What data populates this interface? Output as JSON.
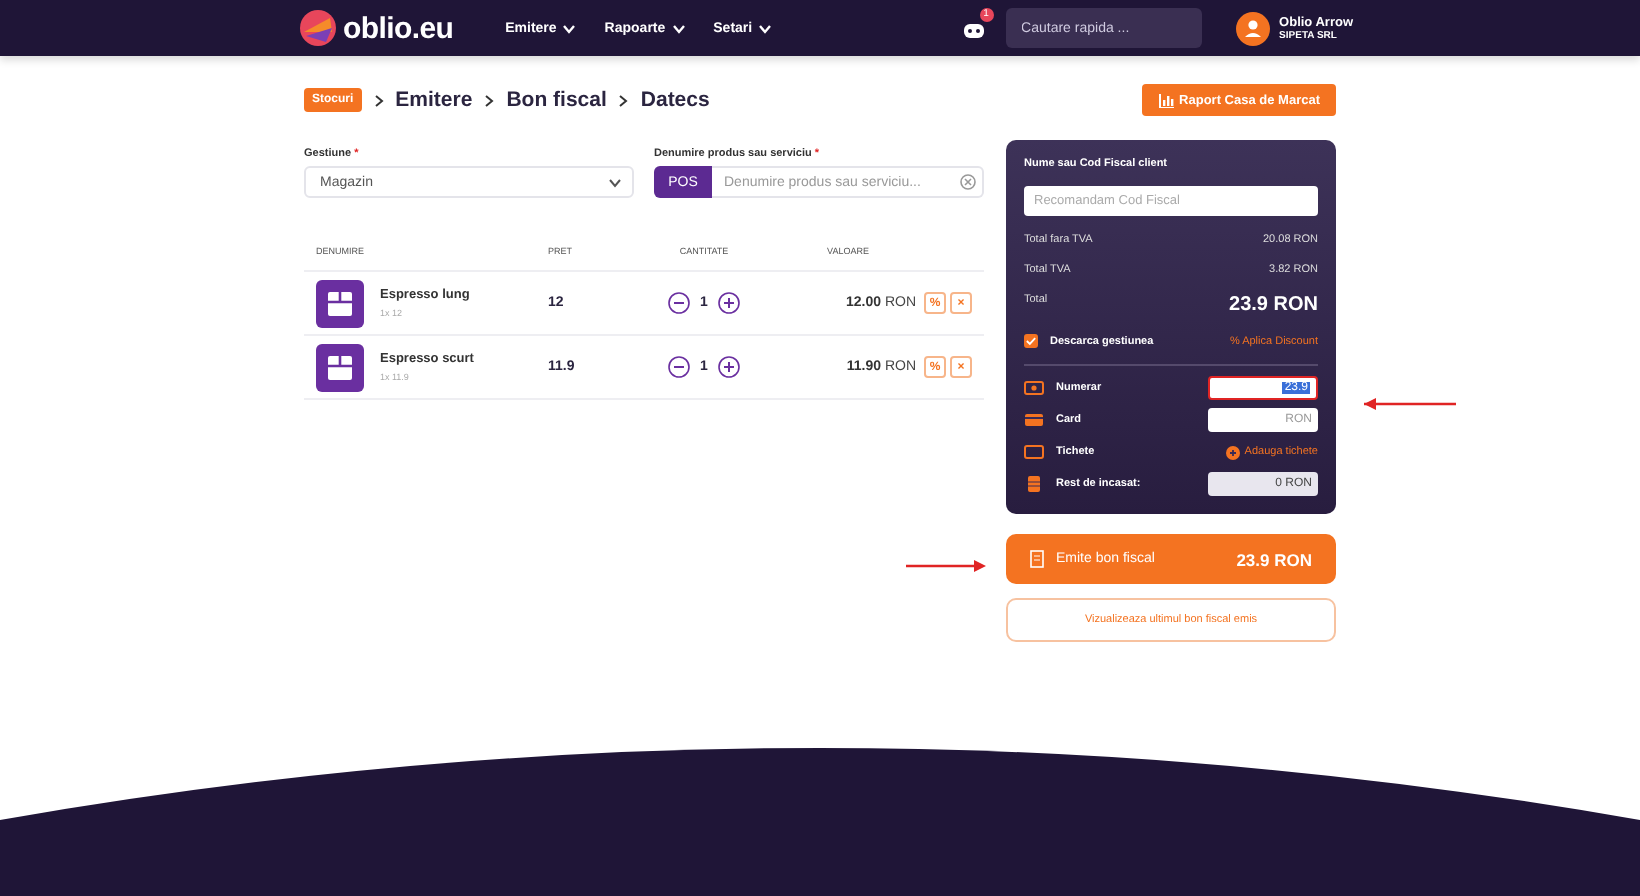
{
  "header": {
    "logo": "oblio.eu",
    "menu": [
      {
        "label": "Emitere"
      },
      {
        "label": "Rapoarte"
      },
      {
        "label": "Setari"
      }
    ],
    "notification_count": "1",
    "search": {
      "placeholder": "Cautare rapida ..."
    },
    "user": {
      "name": "Oblio Arrow",
      "company": "SIPETA SRL"
    }
  },
  "breadcrumb": {
    "badge": "Stocuri",
    "items": [
      "Emitere",
      "Bon fiscal",
      "Datecs"
    ]
  },
  "report_button": "Raport Casa de Marcat",
  "form": {
    "gestiune": {
      "label": "Gestiune",
      "required_mark": "*",
      "value": "Magazin"
    },
    "product": {
      "label": "Denumire produs sau serviciu",
      "required_mark": "*",
      "pos": "POS",
      "placeholder": "Denumire produs sau serviciu..."
    }
  },
  "table": {
    "columns": [
      "DENUMIRE",
      "PRET",
      "CANTITATE",
      "VALOARE"
    ],
    "rows": [
      {
        "name": "Espresso lung",
        "detail": "1x 12",
        "price": "12",
        "quantity": "1",
        "value": "12.00",
        "currency": "RON",
        "discount": "%",
        "remove": "×"
      },
      {
        "name": "Espresso scurt",
        "detail": "1x 11.9",
        "price": "11.9",
        "quantity": "1",
        "value": "11.90",
        "currency": "RON",
        "discount": "%",
        "remove": "×"
      }
    ]
  },
  "panel": {
    "client_label": "Nume sau Cod Fiscal client",
    "client_placeholder": "Recomandam Cod Fiscal",
    "totals": [
      {
        "label": "Total fara TVA",
        "value": "20.08 RON",
        "kind": "small"
      },
      {
        "label": "Total TVA",
        "value": "3.82 RON",
        "kind": "small"
      },
      {
        "label": "Total",
        "value": "23.9 RON",
        "kind": "big"
      }
    ],
    "descarca": {
      "label": "Descarca gestiunea",
      "checked": true
    },
    "discount_link": "% Aplica Discount",
    "payments": [
      {
        "kind": "input",
        "label": "Numerar",
        "value": "23.9",
        "selected": true
      },
      {
        "kind": "input",
        "label": "Card",
        "placeholder": "RON",
        "selected": false
      },
      {
        "kind": "link",
        "label": "Tichete",
        "link": "Adauga tichete"
      },
      {
        "kind": "readonly",
        "label": "Rest de incasat:",
        "value": "0 RON"
      }
    ]
  },
  "emit_button": {
    "label": "Emite bon fiscal",
    "amount": "23.9 RON"
  },
  "last_receipt_button": "Vizualizeaza ultimul bon fiscal emis"
}
